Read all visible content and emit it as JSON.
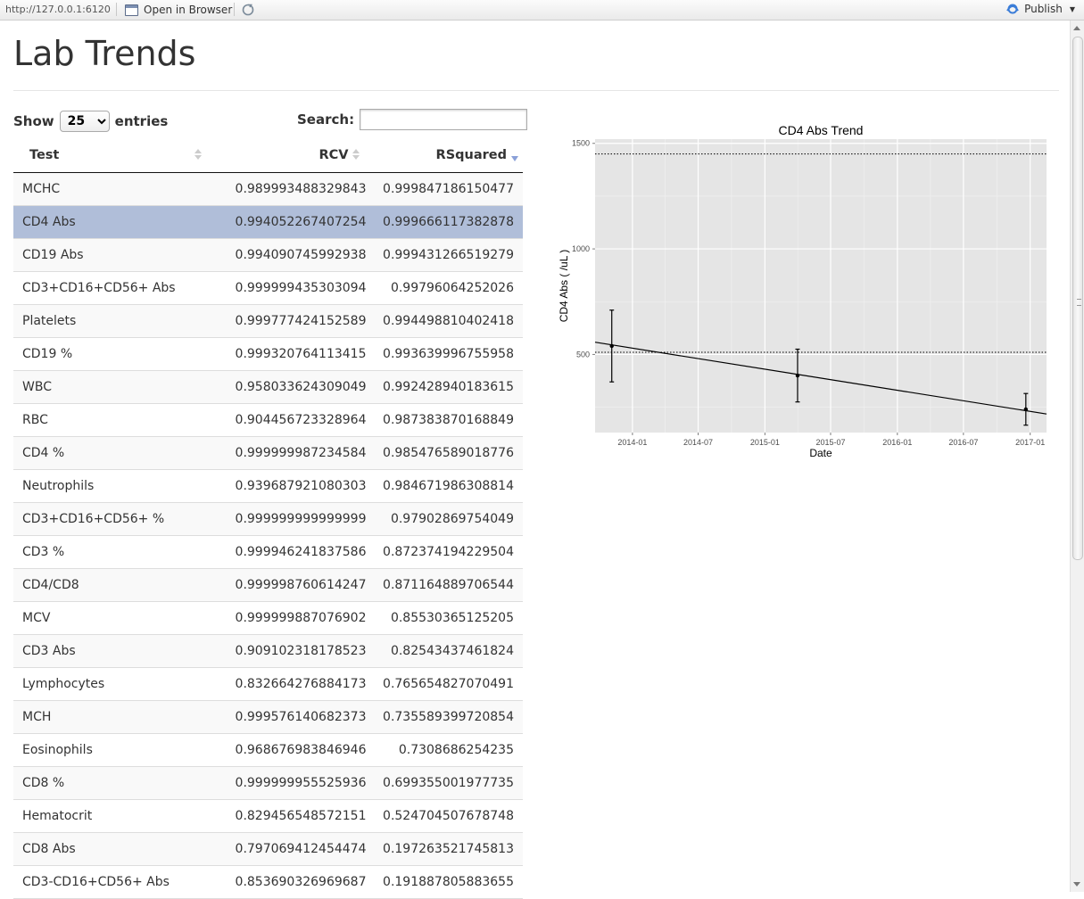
{
  "viewer": {
    "url": "http://127.0.0.1:6120",
    "open_in_browser": "Open in Browser",
    "publish": "Publish"
  },
  "page": {
    "title": "Lab Trends"
  },
  "table_controls": {
    "show_label": "Show",
    "entries_value": "25",
    "entries_label": "entries",
    "search_label": "Search:",
    "search_value": ""
  },
  "table": {
    "columns": [
      "Test",
      "RCV",
      "RSquared"
    ],
    "sorted_column": "RSquared",
    "sort_direction": "descending",
    "selected_row": "CD4 Abs",
    "rows": [
      [
        "MCHC",
        "0.989993488329843",
        "0.999847186150477"
      ],
      [
        "CD4 Abs",
        "0.994052267407254",
        "0.999666117382878"
      ],
      [
        "CD19 Abs",
        "0.994090745992938",
        "0.999431266519279"
      ],
      [
        "CD3+CD16+CD56+ Abs",
        "0.999999435303094",
        "0.99796064252026"
      ],
      [
        "Platelets",
        "0.999777424152589",
        "0.994498810402418"
      ],
      [
        "CD19 %",
        "0.999320764113415",
        "0.993639996755958"
      ],
      [
        "WBC",
        "0.958033624309049",
        "0.992428940183615"
      ],
      [
        "RBC",
        "0.904456723328964",
        "0.987383870168849"
      ],
      [
        "CD4 %",
        "0.999999987234584",
        "0.985476589018776"
      ],
      [
        "Neutrophils",
        "0.939687921080303",
        "0.984671986308814"
      ],
      [
        "CD3+CD16+CD56+ %",
        "0.999999999999999",
        "0.97902869754049"
      ],
      [
        "CD3 %",
        "0.999946241837586",
        "0.872374194229504"
      ],
      [
        "CD4/CD8",
        "0.999998760614247",
        "0.871164889706544"
      ],
      [
        "MCV",
        "0.999999887076902",
        "0.85530365125205"
      ],
      [
        "CD3 Abs",
        "0.909102318178523",
        "0.82543437461824"
      ],
      [
        "Lymphocytes",
        "0.832664276884173",
        "0.765654827070491"
      ],
      [
        "MCH",
        "0.999576140682373",
        "0.735589399720854"
      ],
      [
        "Eosinophils",
        "0.968676983846946",
        "0.7308686254235"
      ],
      [
        "CD8 %",
        "0.999999955525936",
        "0.699355001977735"
      ],
      [
        "Hematocrit",
        "0.829456548572151",
        "0.524704507678748"
      ],
      [
        "CD8 Abs",
        "0.797069412454474",
        "0.197263521745813"
      ],
      [
        "CD3-CD16+CD56+ Abs",
        "0.853690326969687",
        "0.191887805883655"
      ]
    ]
  },
  "chart_data": {
    "type": "scatter",
    "title": "CD4 Abs Trend",
    "xlabel": "Date",
    "ylabel": "CD4 Abs ( /uL )",
    "x_ticks": [
      "2014-01",
      "2014-07",
      "2015-01",
      "2015-07",
      "2016-01",
      "2016-07",
      "2017-01"
    ],
    "y_ticks": [
      500,
      1000,
      1500
    ],
    "xlim": [
      "2013-09-20",
      "2017-02-15"
    ],
    "ylim": [
      130,
      1520
    ],
    "points": [
      {
        "x": "2013-11-05",
        "y": 540,
        "ymin": 370,
        "ymax": 710
      },
      {
        "x": "2015-04-01",
        "y": 400,
        "ymin": 275,
        "ymax": 525
      },
      {
        "x": "2016-12-20",
        "y": 240,
        "ymin": 165,
        "ymax": 315
      }
    ],
    "trend_line": [
      {
        "x": "2013-09-20",
        "y": 558
      },
      {
        "x": "2017-02-15",
        "y": 218
      }
    ],
    "reference_lines": [
      1450,
      510
    ],
    "background": "#e5e5e5",
    "grid": true
  }
}
